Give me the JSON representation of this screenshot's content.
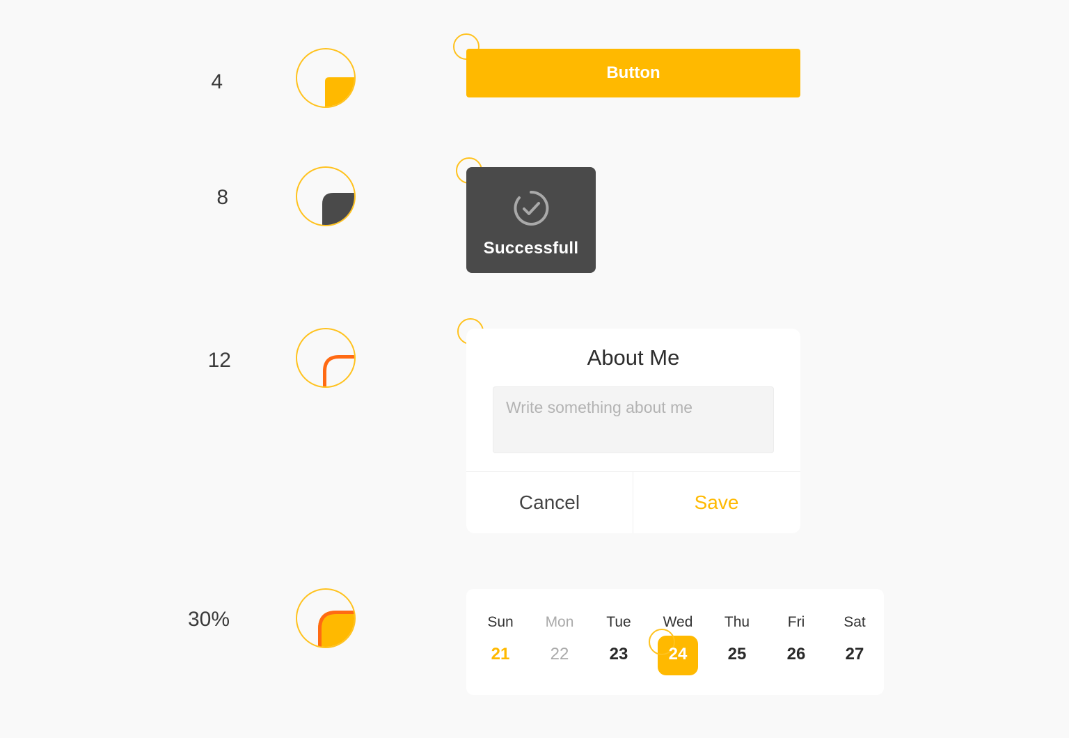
{
  "radii": [
    {
      "label": "4"
    },
    {
      "label": "8"
    },
    {
      "label": "12"
    },
    {
      "label": "30%"
    }
  ],
  "colors": {
    "accent": "#ffb900",
    "marker": "#ffc21e",
    "toast": "#4a4a4a",
    "highlight": "#ff6a13"
  },
  "button": {
    "label": "Button"
  },
  "toast": {
    "icon": "check-circle-icon",
    "text": "Successfull"
  },
  "dialog": {
    "title": "About Me",
    "input_placeholder": "Write something about me",
    "input_value": "",
    "cancel_label": "Cancel",
    "save_label": "Save"
  },
  "calendar": {
    "days": [
      {
        "name": "Sun",
        "date": "21",
        "state": "today"
      },
      {
        "name": "Mon",
        "date": "22",
        "state": "muted"
      },
      {
        "name": "Tue",
        "date": "23",
        "state": "normal"
      },
      {
        "name": "Wed",
        "date": "24",
        "state": "selected"
      },
      {
        "name": "Thu",
        "date": "25",
        "state": "normal"
      },
      {
        "name": "Fri",
        "date": "26",
        "state": "normal"
      },
      {
        "name": "Sat",
        "date": "27",
        "state": "normal"
      }
    ]
  }
}
